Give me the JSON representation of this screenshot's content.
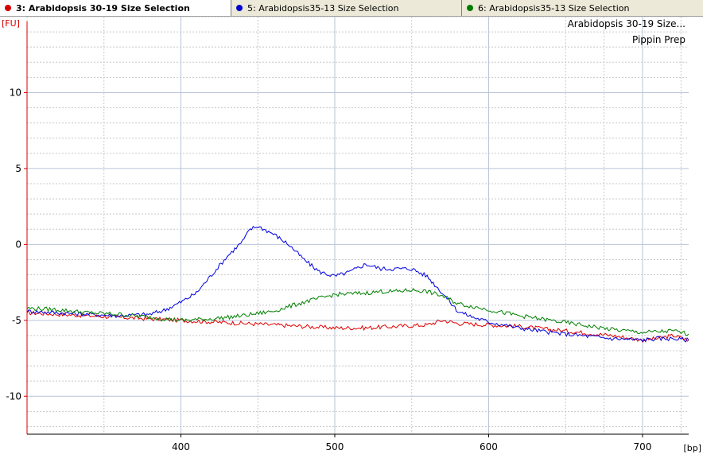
{
  "tabs": [
    {
      "label": "3: Arabidopsis 30-19 Size Selection",
      "color": "#d40000",
      "active": true
    },
    {
      "label": "5: Arabidopsis35-13 Size Selection",
      "color": "#0000d0",
      "active": false
    },
    {
      "label": "6: Arabidopsis35-13  Size Selection",
      "color": "#007a00",
      "active": false
    }
  ],
  "chart_data": {
    "type": "line",
    "title": "Arabidopsis 30-19 Size...",
    "subtitle": "Pippin Prep",
    "ylabel": "[FU]",
    "xlabel": "[bp]",
    "xlim": [
      300,
      730
    ],
    "ylim": [
      -12.5,
      15
    ],
    "x_ticks": [
      400,
      500,
      600,
      700
    ],
    "y_ticks": [
      -10,
      -5,
      0,
      5,
      10
    ],
    "x_minor_ticks": [
      300,
      350,
      450,
      550,
      650,
      675,
      725
    ],
    "grid": true,
    "colors": {
      "axis": "#d40000",
      "grid_major": "#b8c4d8",
      "grid_minor": "#c8c8c8"
    },
    "series": [
      {
        "name": "3: Arabidopsis 30-19 Size Selection",
        "color": "#e00000",
        "x": [
          300,
          320,
          340,
          360,
          380,
          400,
          420,
          440,
          460,
          480,
          500,
          520,
          540,
          560,
          570,
          580,
          600,
          620,
          640,
          660,
          680,
          700,
          710,
          720,
          730
        ],
        "y": [
          -4.5,
          -4.6,
          -4.7,
          -4.8,
          -4.9,
          -5.0,
          -5.1,
          -5.2,
          -5.3,
          -5.4,
          -5.5,
          -5.5,
          -5.4,
          -5.3,
          -5.0,
          -5.2,
          -5.3,
          -5.4,
          -5.6,
          -5.8,
          -6.0,
          -6.3,
          -6.2,
          -6.0,
          -6.3
        ]
      },
      {
        "name": "5: Arabidopsis35-13 Size Selection",
        "color": "#0000e0",
        "x": [
          300,
          320,
          340,
          360,
          380,
          390,
          400,
          410,
          420,
          430,
          440,
          445,
          450,
          460,
          470,
          480,
          490,
          500,
          510,
          520,
          530,
          540,
          550,
          560,
          570,
          580,
          590,
          600,
          620,
          640,
          660,
          680,
          700,
          710,
          720,
          730
        ],
        "y": [
          -4.4,
          -4.5,
          -4.6,
          -4.7,
          -4.6,
          -4.3,
          -3.8,
          -3.2,
          -2.0,
          -0.8,
          0.2,
          1.0,
          1.2,
          0.7,
          0.0,
          -1.0,
          -1.8,
          -2.1,
          -1.8,
          -1.3,
          -1.6,
          -1.6,
          -1.6,
          -2.1,
          -3.2,
          -4.4,
          -4.8,
          -5.1,
          -5.5,
          -5.8,
          -6.0,
          -6.2,
          -6.3,
          -6.2,
          -6.2,
          -6.3
        ]
      },
      {
        "name": "6: Arabidopsis35-13  Size Selection",
        "color": "#008000",
        "x": [
          300,
          320,
          340,
          360,
          380,
          400,
          420,
          440,
          460,
          480,
          500,
          520,
          530,
          540,
          550,
          560,
          570,
          580,
          600,
          620,
          640,
          660,
          680,
          700,
          720,
          730
        ],
        "y": [
          -4.2,
          -4.3,
          -4.5,
          -4.6,
          -4.8,
          -5.0,
          -4.9,
          -4.7,
          -4.4,
          -3.8,
          -3.3,
          -3.2,
          -3.1,
          -3.1,
          -3.0,
          -3.1,
          -3.4,
          -3.9,
          -4.3,
          -4.7,
          -5.0,
          -5.3,
          -5.6,
          -5.8,
          -5.7,
          -5.9
        ]
      }
    ]
  }
}
